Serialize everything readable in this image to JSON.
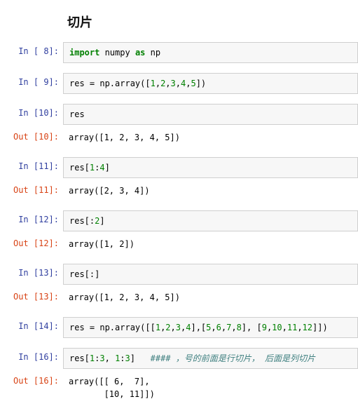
{
  "title": "切片",
  "cells": [
    {
      "kind": "in",
      "n": "8",
      "tokens": [
        {
          "t": "import",
          "c": "kw"
        },
        {
          "t": " numpy ",
          "c": "plain"
        },
        {
          "t": "as",
          "c": "kw"
        },
        {
          "t": " np",
          "c": "plain"
        }
      ]
    },
    {
      "kind": "gap"
    },
    {
      "kind": "in",
      "n": "9",
      "tokens": [
        {
          "t": "res = np.array([",
          "c": "plain"
        },
        {
          "t": "1",
          "c": "num"
        },
        {
          "t": ",",
          "c": "plain"
        },
        {
          "t": "2",
          "c": "num"
        },
        {
          "t": ",",
          "c": "plain"
        },
        {
          "t": "3",
          "c": "num"
        },
        {
          "t": ",",
          "c": "plain"
        },
        {
          "t": "4",
          "c": "num"
        },
        {
          "t": ",",
          "c": "plain"
        },
        {
          "t": "5",
          "c": "num"
        },
        {
          "t": "])",
          "c": "plain"
        }
      ]
    },
    {
      "kind": "gap"
    },
    {
      "kind": "in",
      "n": "10",
      "tokens": [
        {
          "t": "res",
          "c": "plain"
        }
      ]
    },
    {
      "kind": "gap-sm"
    },
    {
      "kind": "out",
      "n": "10",
      "text": "array([1, 2, 3, 4, 5])"
    },
    {
      "kind": "gap"
    },
    {
      "kind": "in",
      "n": "11",
      "tokens": [
        {
          "t": "res[",
          "c": "plain"
        },
        {
          "t": "1",
          "c": "num"
        },
        {
          "t": ":",
          "c": "plain"
        },
        {
          "t": "4",
          "c": "num"
        },
        {
          "t": "]",
          "c": "plain"
        }
      ]
    },
    {
      "kind": "gap-sm"
    },
    {
      "kind": "out",
      "n": "11",
      "text": "array([2, 3, 4])"
    },
    {
      "kind": "gap"
    },
    {
      "kind": "in",
      "n": "12",
      "tokens": [
        {
          "t": "res[:",
          "c": "plain"
        },
        {
          "t": "2",
          "c": "num"
        },
        {
          "t": "]",
          "c": "plain"
        }
      ]
    },
    {
      "kind": "gap-sm"
    },
    {
      "kind": "out",
      "n": "12",
      "text": "array([1, 2])"
    },
    {
      "kind": "gap"
    },
    {
      "kind": "in",
      "n": "13",
      "tokens": [
        {
          "t": "res[:]",
          "c": "plain"
        }
      ]
    },
    {
      "kind": "gap-sm"
    },
    {
      "kind": "out",
      "n": "13",
      "text": "array([1, 2, 3, 4, 5])"
    },
    {
      "kind": "gap"
    },
    {
      "kind": "in",
      "n": "14",
      "tokens": [
        {
          "t": "res = np.array([[",
          "c": "plain"
        },
        {
          "t": "1",
          "c": "num"
        },
        {
          "t": ",",
          "c": "plain"
        },
        {
          "t": "2",
          "c": "num"
        },
        {
          "t": ",",
          "c": "plain"
        },
        {
          "t": "3",
          "c": "num"
        },
        {
          "t": ",",
          "c": "plain"
        },
        {
          "t": "4",
          "c": "num"
        },
        {
          "t": "],[",
          "c": "plain"
        },
        {
          "t": "5",
          "c": "num"
        },
        {
          "t": ",",
          "c": "plain"
        },
        {
          "t": "6",
          "c": "num"
        },
        {
          "t": ",",
          "c": "plain"
        },
        {
          "t": "7",
          "c": "num"
        },
        {
          "t": ",",
          "c": "plain"
        },
        {
          "t": "8",
          "c": "num"
        },
        {
          "t": "], [",
          "c": "plain"
        },
        {
          "t": "9",
          "c": "num"
        },
        {
          "t": ",",
          "c": "plain"
        },
        {
          "t": "10",
          "c": "num"
        },
        {
          "t": ",",
          "c": "plain"
        },
        {
          "t": "11",
          "c": "num"
        },
        {
          "t": ",",
          "c": "plain"
        },
        {
          "t": "12",
          "c": "num"
        },
        {
          "t": "]])",
          "c": "plain"
        }
      ]
    },
    {
      "kind": "gap"
    },
    {
      "kind": "in",
      "n": "16",
      "tokens": [
        {
          "t": "res[",
          "c": "plain"
        },
        {
          "t": "1",
          "c": "num"
        },
        {
          "t": ":",
          "c": "plain"
        },
        {
          "t": "3",
          "c": "num"
        },
        {
          "t": ", ",
          "c": "plain"
        },
        {
          "t": "1",
          "c": "num"
        },
        {
          "t": ":",
          "c": "plain"
        },
        {
          "t": "3",
          "c": "num"
        },
        {
          "t": "]   ",
          "c": "plain"
        },
        {
          "t": "#### ，号的前面是行切片， 后面是列切片",
          "c": "comment"
        }
      ]
    },
    {
      "kind": "gap-sm"
    },
    {
      "kind": "out",
      "n": "16",
      "text": "array([[ 6,  7],\n       [10, 11]])"
    }
  ],
  "labels": {
    "in": "In ",
    "out": "Out"
  }
}
